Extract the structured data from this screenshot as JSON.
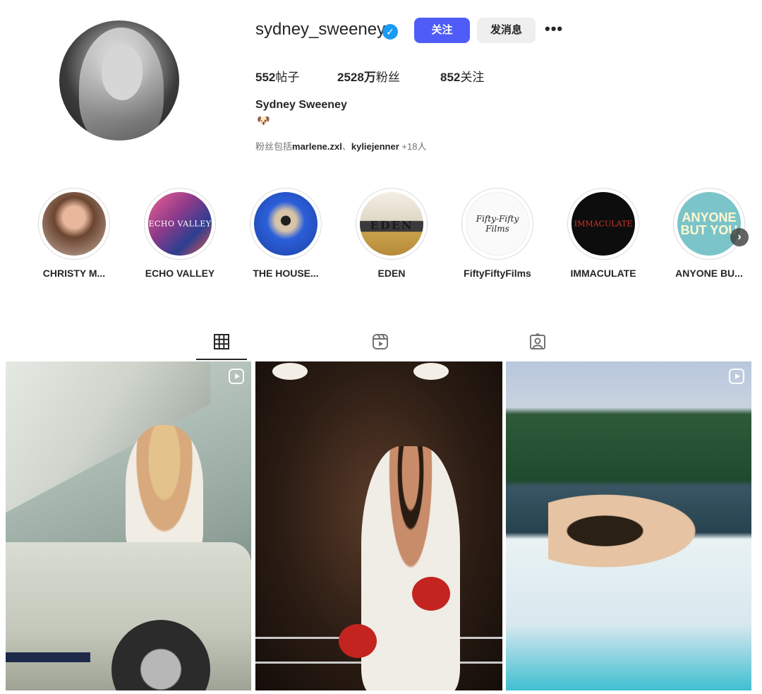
{
  "profile": {
    "username": "sydney_sweeney",
    "verified_icon": "verified-badge-icon",
    "follow_label": "关注",
    "message_label": "发消息",
    "more_label": "•••",
    "stats": {
      "posts_count": "552",
      "posts_label": "帖子",
      "followers_count": "2528万",
      "followers_label": "粉丝",
      "following_count": "852",
      "following_label": "关注"
    },
    "full_name": "Sydney Sweeney",
    "bio_emoji": "🐶",
    "followed_by": {
      "prefix": "粉丝包括",
      "user1": "marlene.zxl",
      "separator": "、",
      "user2": "kyliejenner",
      "suffix": " +18人"
    }
  },
  "highlights": [
    {
      "label": "CHRISTY M...",
      "cover_text": ""
    },
    {
      "label": "ECHO VALLEY",
      "cover_text": "ECHO VALLEY"
    },
    {
      "label": "THE HOUSE...",
      "cover_text": ""
    },
    {
      "label": "EDEN",
      "cover_text": "EDEN"
    },
    {
      "label": "FiftyFiftyFilms",
      "cover_text": "Fifty-Fifty Films"
    },
    {
      "label": "IMMACULATE",
      "cover_text": "IMMACULATE"
    },
    {
      "label": "ANYONE BU...",
      "cover_text": "ANYONE BUT YOU"
    }
  ],
  "tabs": [
    {
      "name": "posts",
      "icon": "grid-icon",
      "active": true
    },
    {
      "name": "reels",
      "icon": "reels-icon",
      "active": false
    },
    {
      "name": "tagged",
      "icon": "tagged-icon",
      "active": false
    }
  ],
  "colors": {
    "follow_button": "#4f5cf7",
    "message_button": "#efefef",
    "verified": "#1a9af5",
    "text": "#262626",
    "secondary_text": "#737373"
  },
  "grid": {
    "posts": [
      {
        "type": "reel",
        "badge_icon": "reel-icon"
      },
      {
        "type": "image"
      },
      {
        "type": "reel",
        "badge_icon": "reel-icon"
      }
    ]
  }
}
